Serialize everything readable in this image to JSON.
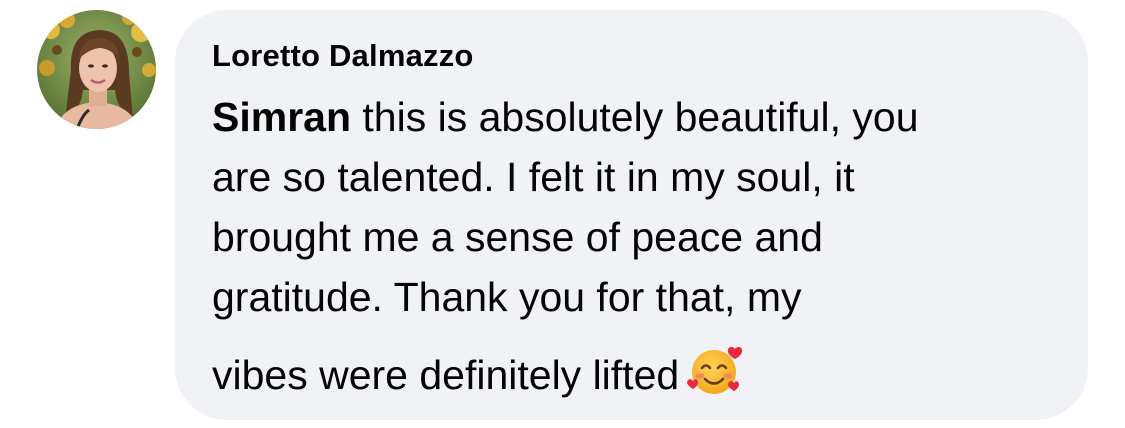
{
  "comment": {
    "author": "Loretto Dalmazzo",
    "mention": "Simran",
    "lines": [
      " this is absolutely beautiful, you",
      "are so talented. I felt it in my soul, it",
      "brought me a sense of peace and",
      "gratitude.  Thank you for that, my",
      "vibes were definitely lifted"
    ],
    "emoji": "smiling-face-with-hearts-emoji"
  }
}
